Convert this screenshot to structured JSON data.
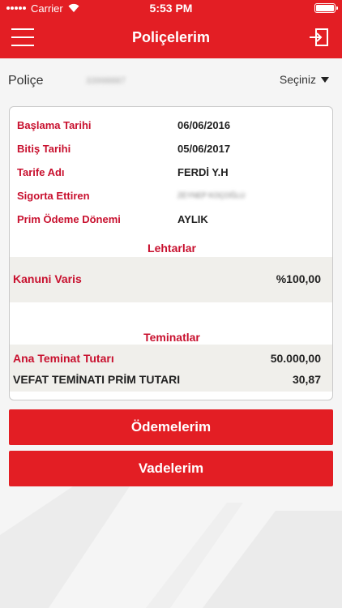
{
  "status_bar": {
    "carrier": "Carrier",
    "time": "5:53 PM"
  },
  "nav": {
    "title": "Poliçelerim",
    "menu_icon": "hamburger-menu-icon",
    "logout_icon": "logout-icon"
  },
  "policy_selector": {
    "label": "Poliçe",
    "number": "33998887",
    "select_label": "Seçiniz"
  },
  "policy_details": [
    {
      "label": "Başlama Tarihi",
      "value": "06/06/2016"
    },
    {
      "label": "Bitiş Tarihi",
      "value": "05/06/2017"
    },
    {
      "label": "Tarife Adı",
      "value": "FERDİ Y.H"
    },
    {
      "label": "Sigorta Ettiren",
      "value": "ZEYNEP KOÇOĞLU"
    },
    {
      "label": "Prim Ödeme Dönemi",
      "value": "AYLIK"
    }
  ],
  "beneficiaries": {
    "heading": "Lehtarlar",
    "items": [
      {
        "label": "Kanuni Varis",
        "value": "%100,00"
      }
    ]
  },
  "coverages": {
    "heading": "Teminatlar",
    "items": [
      {
        "label": "Ana Teminat Tutarı",
        "value": "50.000,00"
      },
      {
        "label": "VEFAT TEMİNATI PRİM TUTARI",
        "value": "30,87"
      }
    ]
  },
  "buttons": {
    "payments": "Ödemelerim",
    "maturities": "Vadelerim"
  },
  "colors": {
    "brand_red": "#e31e24",
    "label_red": "#c8102e"
  }
}
